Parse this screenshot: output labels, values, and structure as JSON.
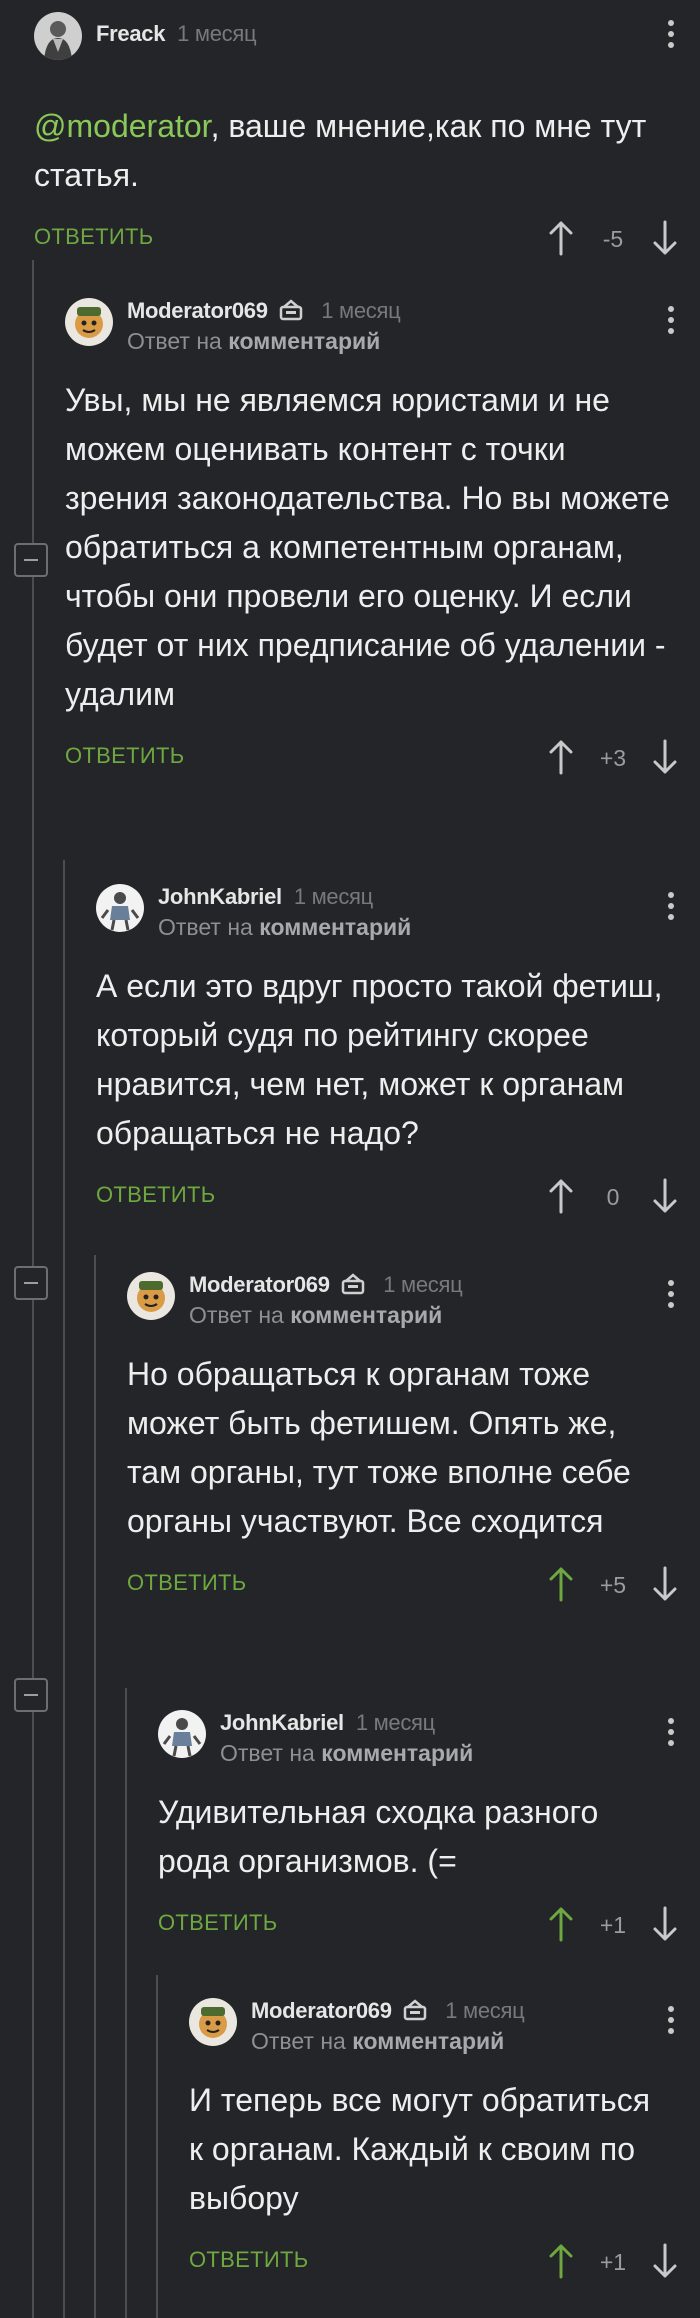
{
  "comments": [
    {
      "user": "Freack",
      "time": "1 месяц",
      "mention": "@moderator",
      "text": ", ваше мнение,как по мне тут статья.",
      "reply_label": "ОТВЕТИТЬ",
      "score": "-5"
    },
    {
      "user": "Moderator069",
      "time": "1 месяц",
      "reply_prefix": "Ответ на",
      "reply_target": "комментарий",
      "text": "Увы, мы не являемся юристами и не можем оценивать контент с точки зрения законодательства. Но вы можете обратиться а компетентным органам, чтобы они провели его оценку. И если будет от них предписание об удалении - удалим",
      "reply_label": "ОТВЕТИТЬ",
      "score": "+3"
    },
    {
      "user": "JohnKabriel",
      "time": "1 месяц",
      "reply_prefix": "Ответ на",
      "reply_target": "комментарий",
      "text": "А если это вдруг просто такой фетиш, который судя по рейтингу скорее нравится, чем нет, может к органам обращаться не надо?",
      "reply_label": "ОТВЕТИТЬ",
      "score": "0"
    },
    {
      "user": "Moderator069",
      "time": "1 месяц",
      "reply_prefix": "Ответ на",
      "reply_target": "комментарий",
      "text": "Но обращаться к органам тоже может быть фетишем. Опять же, там органы, тут тоже вполне себе органы участвуют. Все сходится",
      "reply_label": "ОТВЕТИТЬ",
      "score": "+5"
    },
    {
      "user": "JohnKabriel",
      "time": "1 месяц",
      "reply_prefix": "Ответ на",
      "reply_target": "комментарий",
      "text": "Удивительная сходка разного рода организмов. (=",
      "reply_label": "ОТВЕТИТЬ",
      "score": "+1"
    },
    {
      "user": "Moderator069",
      "time": "1 месяц",
      "reply_prefix": "Ответ на",
      "reply_target": "комментарий",
      "text": "И теперь все могут обратиться к органам. Каждый к своим по выбору",
      "reply_label": "ОТВЕТИТЬ",
      "score": "+1"
    }
  ],
  "colors": {
    "background": "#232528",
    "accent_green": "#6ea840",
    "mention_green": "#8ac858",
    "upvoted_arrow": "#6ea840"
  },
  "icons": {
    "moderator_badge": "moderator-badge-icon",
    "upvote": "arrow-up-icon",
    "downvote": "arrow-down-icon",
    "menu": "more-vertical-icon",
    "collapse": "collapse-thread-icon"
  }
}
